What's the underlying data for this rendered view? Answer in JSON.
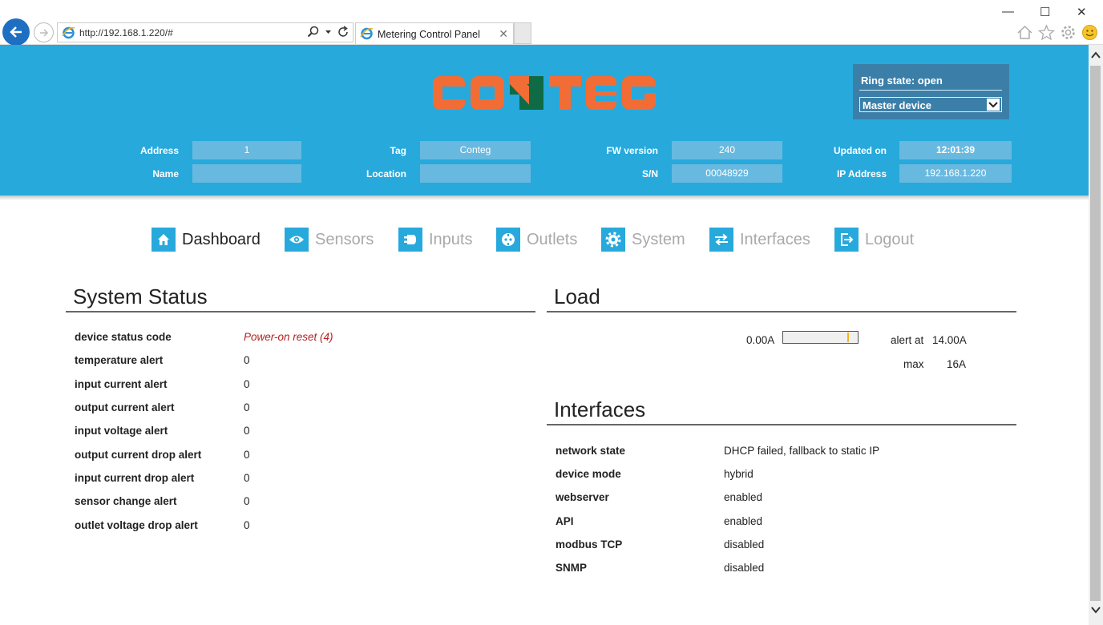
{
  "browser": {
    "url": "http://192.168.1.220/#",
    "tab_title": "Metering Control Panel",
    "minimize": "—",
    "maximize": "☐",
    "close": "✕"
  },
  "header": {
    "logo_text": "CONTEG",
    "ring_state": "Ring state: open",
    "device_select": "Master device",
    "fields": {
      "address_label": "Address",
      "address_value": "1",
      "name_label": "Name",
      "name_value": "",
      "tag_label": "Tag",
      "tag_value": "Conteg",
      "location_label": "Location",
      "location_value": "",
      "fw_label": "FW version",
      "fw_value": "240",
      "sn_label": "S/N",
      "sn_value": "00048929",
      "updated_label": "Updated on",
      "updated_value": "12:01:39",
      "ip_label": "IP Address",
      "ip_value": "192.168.1.220"
    }
  },
  "nav": {
    "dashboard": "Dashboard",
    "sensors": "Sensors",
    "inputs": "Inputs",
    "outlets": "Outlets",
    "system": "System",
    "interfaces": "Interfaces",
    "logout": "Logout"
  },
  "system_status": {
    "title": "System Status",
    "rows": [
      {
        "label": "device status code",
        "value": "Power-on reset (4)"
      },
      {
        "label": "temperature alert",
        "value": "0"
      },
      {
        "label": "input current alert",
        "value": "0"
      },
      {
        "label": "output current alert",
        "value": "0"
      },
      {
        "label": "input voltage alert",
        "value": "0"
      },
      {
        "label": "output current drop alert",
        "value": "0"
      },
      {
        "label": "input current drop alert",
        "value": "0"
      },
      {
        "label": "sensor change alert",
        "value": "0"
      },
      {
        "label": "outlet voltage drop alert",
        "value": "0"
      }
    ]
  },
  "load": {
    "title": "Load",
    "current": "0.00A",
    "alert_label": "alert at",
    "alert_value": "14.00A",
    "max_label": "max",
    "max_value": "16A",
    "alert_fraction": 0.875
  },
  "interfaces": {
    "title": "Interfaces",
    "rows": [
      {
        "label": "network state",
        "value": "DHCP failed, fallback to static IP"
      },
      {
        "label": "device mode",
        "value": "hybrid"
      },
      {
        "label": "webserver",
        "value": "enabled"
      },
      {
        "label": "API",
        "value": "enabled"
      },
      {
        "label": "modbus TCP",
        "value": "disabled"
      },
      {
        "label": "SNMP",
        "value": "disabled"
      }
    ]
  },
  "colors": {
    "header_bg": "#27a9dc",
    "logo_orange": "#f26c35",
    "logo_green": "#0f6b45",
    "error_red": "#b22222"
  }
}
